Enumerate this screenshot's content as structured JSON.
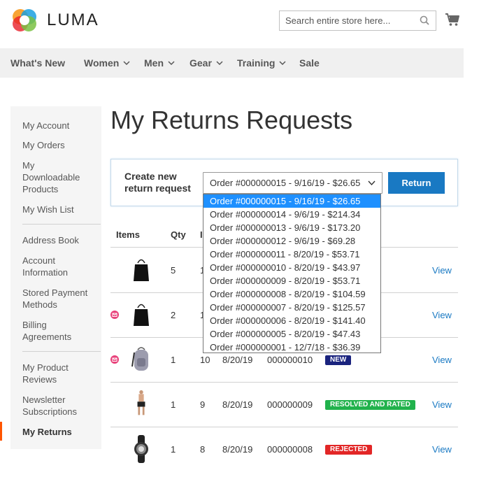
{
  "header": {
    "brand": "LUMA",
    "search_placeholder": "Search entire store here..."
  },
  "nav": {
    "items": [
      {
        "label": "What's New",
        "has_menu": false
      },
      {
        "label": "Women",
        "has_menu": true
      },
      {
        "label": "Men",
        "has_menu": true
      },
      {
        "label": "Gear",
        "has_menu": true
      },
      {
        "label": "Training",
        "has_menu": true
      },
      {
        "label": "Sale",
        "has_menu": false
      }
    ]
  },
  "sidebar": {
    "items": [
      "My Account",
      "My Orders",
      "My Downloadable Products",
      "My Wish List",
      "Address Book",
      "Account Information",
      "Stored Payment Methods",
      "Billing Agreements",
      "My Product Reviews",
      "Newsletter Subscriptions",
      "My Returns"
    ],
    "active": "My Returns",
    "accent_color": "#ff5501"
  },
  "main": {
    "title": "My Returns Requests",
    "create": {
      "label": "Create new return request",
      "selected": "Order #000000015 - 9/16/19 - $26.65",
      "button": "Return"
    },
    "dropdown_options": [
      "Order #000000015 - 9/16/19 - $26.65",
      "Order #000000014 - 9/6/19 - $214.34",
      "Order #000000013 - 9/6/19 - $173.20",
      "Order #000000012 - 9/6/19 - $69.28",
      "Order #000000011 - 8/20/19 - $53.71",
      "Order #000000010 - 8/20/19 - $43.97",
      "Order #000000009 - 8/20/19 - $53.71",
      "Order #000000008 - 8/20/19 - $104.59",
      "Order #000000007 - 8/20/19 - $125.57",
      "Order #000000006 - 8/20/19 - $141.40",
      "Order #000000005 - 8/20/19 - $47.43",
      "Order #000000001 - 12/7/18 - $36.39"
    ],
    "table": {
      "headers": {
        "items": "Items",
        "qty": "Qty",
        "id_partial": "I"
      },
      "rows": [
        {
          "qty": "5",
          "id": "1",
          "date": "",
          "order": "",
          "status": "",
          "status_color": "",
          "action": "View",
          "has_message": false,
          "thumb": "bag-icon"
        },
        {
          "qty": "2",
          "id": "1",
          "date": "",
          "order": "",
          "status": "",
          "status_color": "",
          "action": "View",
          "has_message": true,
          "thumb": "bag-icon"
        },
        {
          "qty": "1",
          "id": "10",
          "date": "8/20/19",
          "order": "000000010",
          "status": "NEW",
          "status_color": "#1a237e",
          "action": "View",
          "has_message": true,
          "thumb": "backpack-icon"
        },
        {
          "qty": "1",
          "id": "9",
          "date": "8/20/19",
          "order": "000000009",
          "status": "RESOLVED AND RATED",
          "status_color": "#21b24c",
          "action": "View",
          "has_message": false,
          "thumb": "shorts-icon"
        },
        {
          "qty": "1",
          "id": "8",
          "date": "8/20/19",
          "order": "000000008",
          "status": "REJECTED",
          "status_color": "#e22626",
          "action": "View",
          "has_message": false,
          "thumb": "watch-icon"
        }
      ]
    }
  },
  "colors": {
    "primary": "#1979c3",
    "nav_bg": "#f0f0f0",
    "sidebar_bg": "#f5f5f5",
    "dropdown_selected": "#1e90ff"
  }
}
